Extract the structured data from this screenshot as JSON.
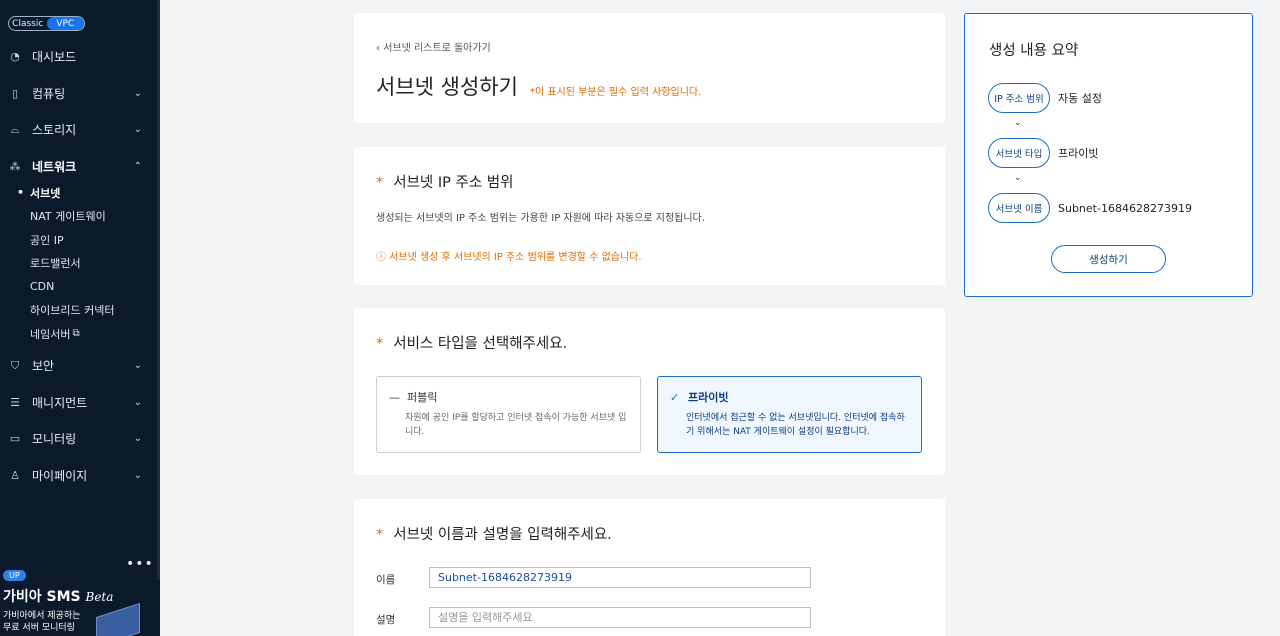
{
  "sidebar": {
    "toggle": {
      "classic": "Classic",
      "vpc": "VPC"
    },
    "items": [
      {
        "label": "대시보드"
      },
      {
        "label": "컴퓨팅"
      },
      {
        "label": "스토리지"
      },
      {
        "label": "네트워크"
      },
      {
        "label": "보안"
      },
      {
        "label": "매니지먼트"
      },
      {
        "label": "모니터링"
      },
      {
        "label": "마이페이지"
      }
    ],
    "network_sub": [
      "서브넷",
      "NAT 게이트웨이",
      "공인 IP",
      "로드밸런서",
      "CDN",
      "하이브리드 커넥터",
      "네임서버"
    ],
    "dots": "•••",
    "promo": {
      "badge": "UP",
      "title": "가비아 SMS",
      "title_suffix": "Beta",
      "line1": "가비아에서 제공하는",
      "line2": "무료 서버 모니터링"
    }
  },
  "header": {
    "back_link": "서브넷 리스트로 돌아가기",
    "title": "서브넷 생성하기",
    "required_note": "*이 표시된 부분은 필수 입력 사항입니다."
  },
  "ip_section": {
    "title": "서브넷 IP 주소 범위",
    "desc": "생성되는 서브넷의 IP 주소 범위는 가용한 IP 자원에 따라 자동으로 지정됩니다.",
    "warning": "ⓘ 서브넷 생성 후 서브넷의 IP 주소 범위를 변경할 수 없습니다."
  },
  "type_section": {
    "title": "서비스 타입을 선택해주세요.",
    "options": [
      {
        "label": "퍼블릭",
        "mark": "—",
        "desc": "자원에 공인 IP를 할당하고 인터넷 접속이 가능한 서브넷 입니다."
      },
      {
        "label": "프라이빗",
        "mark": "✓",
        "desc": "인터넷에서 접근할 수 없는 서브넷입니다. 인터넷에 접속하기 위해서는 NAT 게이트웨이 설정이 필요합니다."
      }
    ],
    "selected": "프라이빗"
  },
  "name_section": {
    "title": "서브넷 이름과 설명을 입력해주세요.",
    "name_label": "이름",
    "name_value": "Subnet-1684628273919",
    "desc_label": "설명",
    "desc_placeholder": "설명을 입력해주세요"
  },
  "summary": {
    "title": "생성 내용 요약",
    "rows": [
      {
        "pill": "IP 주소 범위",
        "value": "자동 설정"
      },
      {
        "pill": "서브넷 타입",
        "value": "프라이빗"
      },
      {
        "pill": "서브넷 이름",
        "value": "Subnet-1684628273919"
      }
    ],
    "create_label": "생성하기"
  },
  "colors": {
    "accent": "#1c6dc8",
    "warning": "#e06c00",
    "sidebar_bg": "#0b1a2b"
  }
}
